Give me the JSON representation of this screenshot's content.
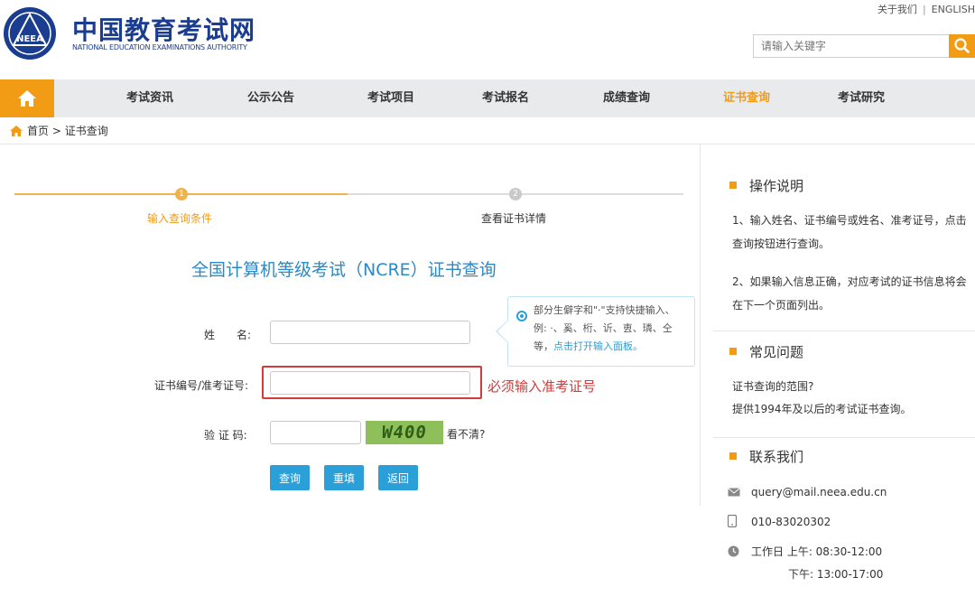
{
  "header": {
    "logo_title": "中国教育考试网",
    "logo_sub": "NATIONAL EDUCATION EXAMINATIONS AUTHORITY",
    "logo_emblem_text": "NEEA",
    "top_links": [
      "关于我们",
      "ENGLISH"
    ],
    "search_placeholder": "请输入关键字"
  },
  "nav": {
    "items": [
      "考试资讯",
      "公示公告",
      "考试项目",
      "考试报名",
      "成绩查询",
      "证书查询",
      "考试研究"
    ],
    "active": "证书查询"
  },
  "breadcrumb": {
    "home": "首页",
    "current": "> 证书查询"
  },
  "steps": [
    {
      "num": "1",
      "label": "输入查询条件"
    },
    {
      "num": "2",
      "label": "查看证书详情"
    }
  ],
  "form": {
    "title": "全国计算机等级考试（NCRE）证书查询",
    "name_label": "姓　　名:",
    "cert_label": "证书编号/准考证号:",
    "captcha_label": "验 证 码:",
    "captcha_text": "W400",
    "captcha_refresh": "看不清?",
    "error_msg": "必须输入准考证号",
    "buttons": [
      "查询",
      "重填",
      "返回"
    ]
  },
  "tooltip": {
    "line1": "部分生僻字和\"·\"支持快捷输入、",
    "line2": "例: ·、奚、桁、䜣、叀、璘、仝",
    "line3_prefix": "等，",
    "line3_link": "点击打开输入面板。"
  },
  "sidebar": {
    "ops_title": "操作说明",
    "ops_1": "1、输入姓名、证书编号或姓名、准考证号，点击查询按钮进行查询。",
    "ops_2": "2、如果输入信息正确，对应考试的证书信息将会在下一个页面列出。",
    "faq_title": "常见问题",
    "faq_q": "证书查询的范围?",
    "faq_a": "提供1994年及以后的考试证书查询。",
    "contact_title": "联系我们",
    "email": "query@mail.neea.edu.cn",
    "phone": "010-83020302",
    "hours_1": "工作日 上午: 08:30-12:00",
    "hours_2": "下午: 13:00-17:00"
  },
  "colors": {
    "accent": "#f29b15",
    "link_blue": "#2a9fd8",
    "error_red": "#d23b3b",
    "logo_blue": "#1a3d8f"
  }
}
